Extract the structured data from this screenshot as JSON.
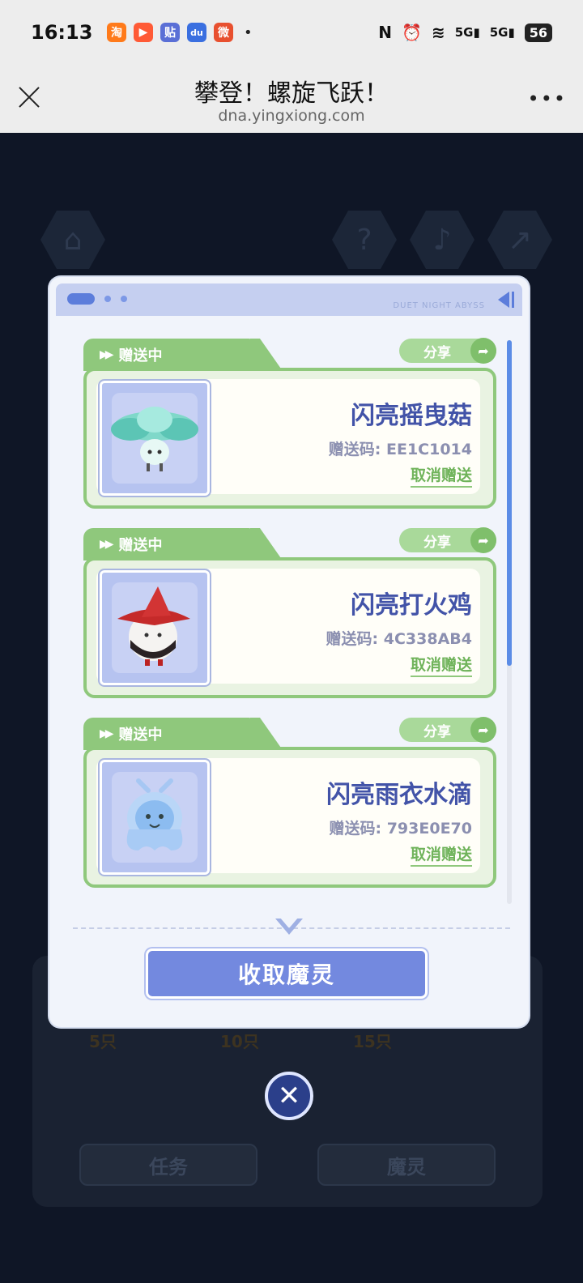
{
  "status_bar": {
    "time": "16:13",
    "apps": [
      {
        "icon": "taobao-icon",
        "glyph": "淘",
        "color": "#ff7a1a"
      },
      {
        "icon": "video-icon",
        "glyph": "▶",
        "color": "#ff5a36"
      },
      {
        "icon": "tieba-icon",
        "glyph": "贴",
        "color": "#5a6fd6"
      },
      {
        "icon": "baidu-icon",
        "glyph": "du",
        "color": "#3a6fe0"
      },
      {
        "icon": "weibo-icon",
        "glyph": "微",
        "color": "#e8502f"
      }
    ],
    "more_dot": "•",
    "nfc": "N",
    "alarm": "⏰",
    "wifi": "≋",
    "sig1": "5G▮",
    "sig2": "5G▮",
    "battery": "56"
  },
  "browser": {
    "title": "攀登！螺旋飞跃！",
    "domain": "dna.yingxiong.com",
    "menu": "•••"
  },
  "backdrop": {
    "home": "⌂",
    "help": "?",
    "music": "♪",
    "share": "↗",
    "tiers": [
      "5只",
      "10只",
      "15只"
    ],
    "tabs": [
      "任务",
      "魔灵"
    ]
  },
  "modal": {
    "brand_text": "DUET NIGHT ABYSS",
    "collect_label": "收取魔灵",
    "cards": [
      {
        "status": "赠送中",
        "share": "分享",
        "name": "闪亮摇曳菇",
        "code": "赠送码: EE1C1014",
        "cancel": "取消赠送"
      },
      {
        "status": "赠送中",
        "share": "分享",
        "name": "闪亮打火鸡",
        "code": "赠送码: 4C338AB4",
        "cancel": "取消赠送"
      },
      {
        "status": "赠送中",
        "share": "分享",
        "name": "闪亮雨衣水滴",
        "code": "赠送码: 793E0E70",
        "cancel": "取消赠送"
      }
    ]
  }
}
